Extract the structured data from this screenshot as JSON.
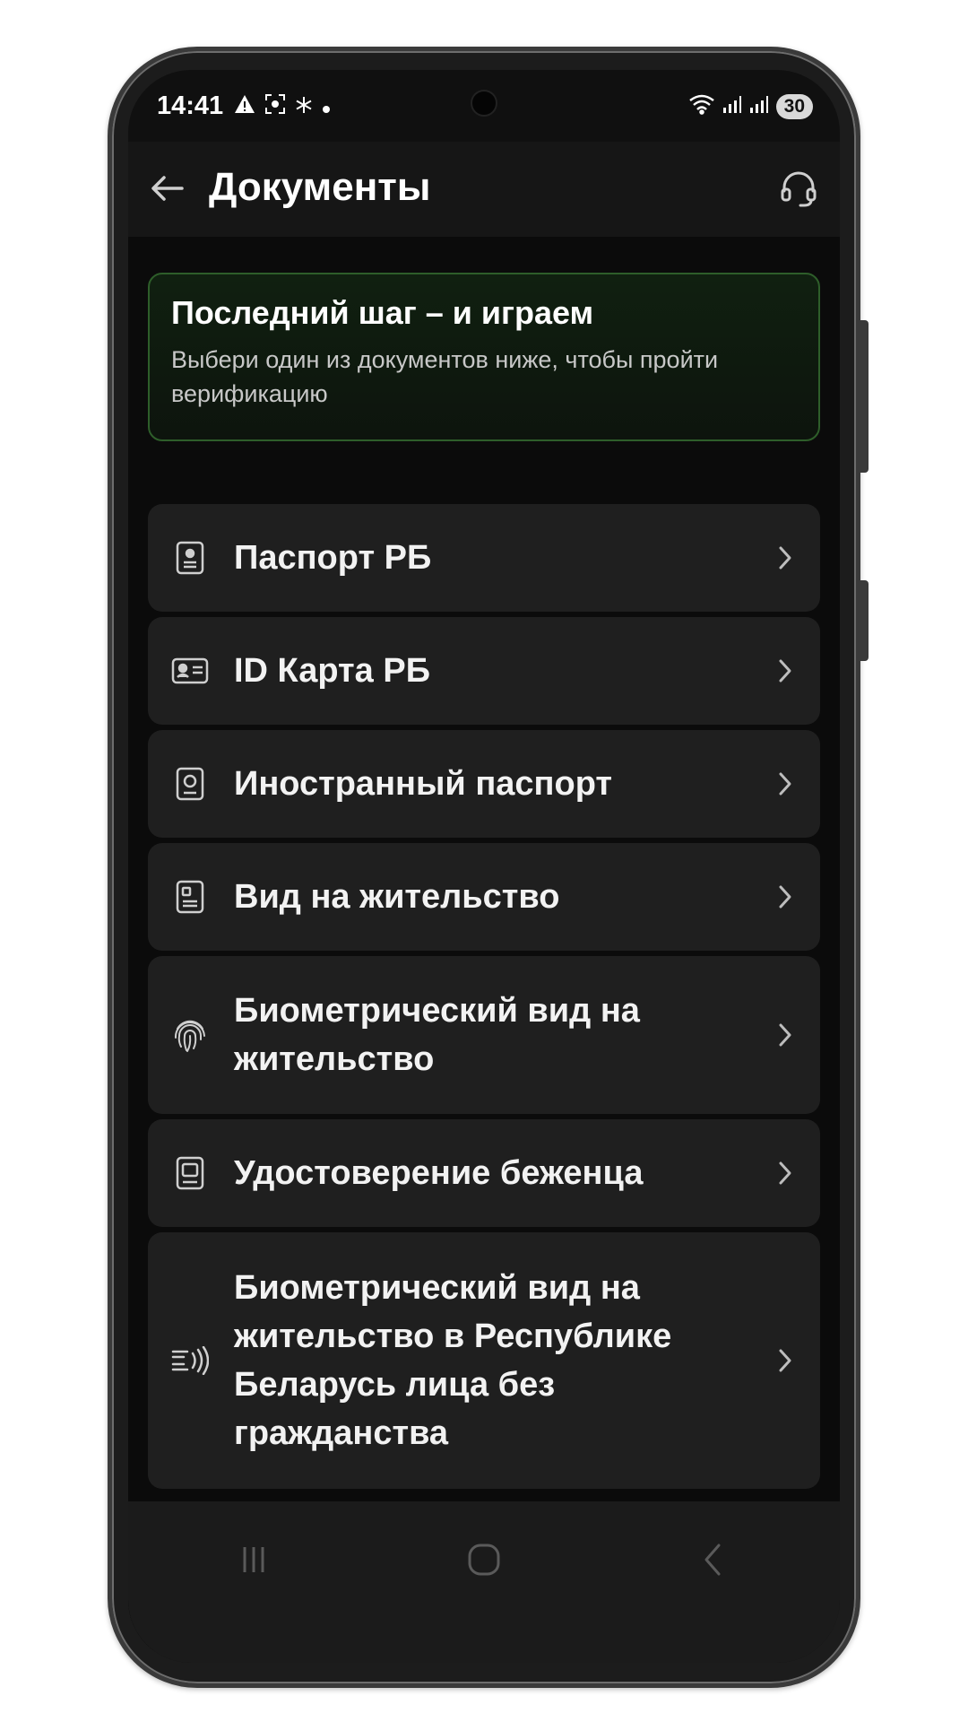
{
  "status_bar": {
    "time": "14:41",
    "battery": "30",
    "left_icons": [
      "alert-icon",
      "screenshot-icon",
      "snowflake-icon",
      "dot-icon"
    ],
    "right_icons": [
      "wifi-icon",
      "signal-icon",
      "signal-icon"
    ]
  },
  "header": {
    "title": "Документы"
  },
  "banner": {
    "title": "Последний шаг – и играем",
    "text": "Выбери один из документов ниже, чтобы пройти верификацию"
  },
  "documents": [
    {
      "label": "Паспорт РБ",
      "icon": "passport-icon"
    },
    {
      "label": "ID Карта РБ",
      "icon": "id-card-icon"
    },
    {
      "label": "Иностранный паспорт",
      "icon": "foreign-passport-icon"
    },
    {
      "label": "Вид на жительство",
      "icon": "residence-permit-icon"
    },
    {
      "label": "Биометрический вид на жительство",
      "icon": "fingerprint-icon"
    },
    {
      "label": "Удостоверение беженца",
      "icon": "refugee-certificate-icon"
    },
    {
      "label": "Биометрический вид на жительство в Республике Беларусь лица без гражданства",
      "icon": "contactless-icon"
    }
  ],
  "colors": {
    "background": "#0b0b0b",
    "card": "#1f1f1f",
    "accent_border": "#2e5e2a"
  }
}
